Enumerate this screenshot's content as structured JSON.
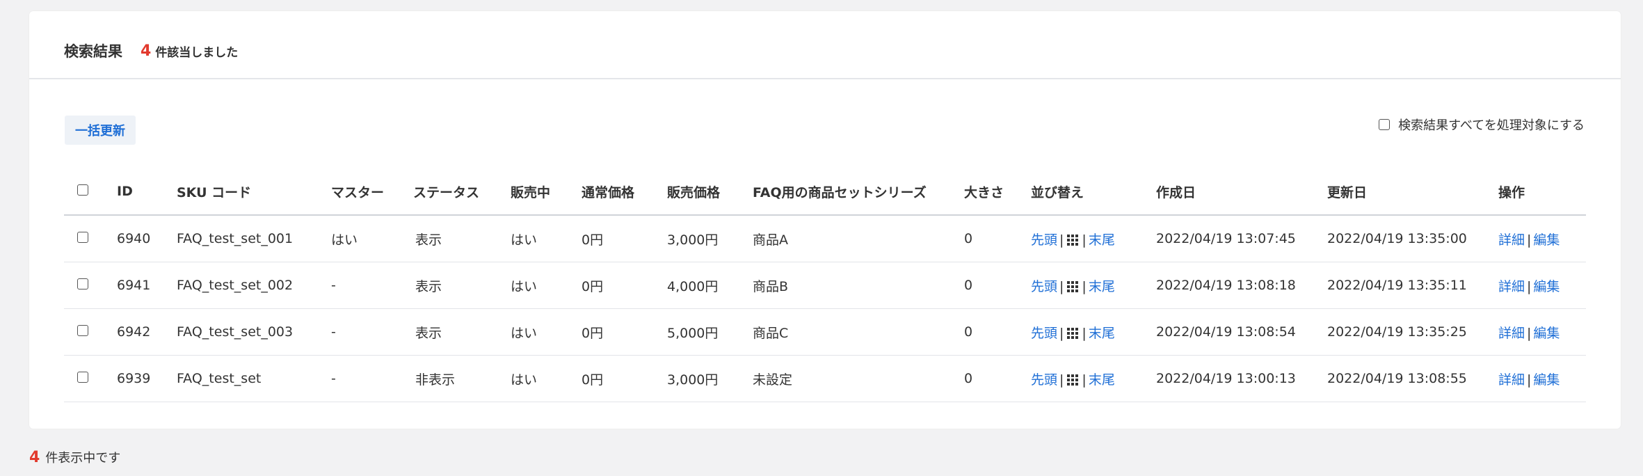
{
  "header": {
    "title": "検索結果",
    "count": "4",
    "count_suffix": "件該当しました"
  },
  "bulk_update_label": "一括更新",
  "all_target_label": "検索結果すべてを処理対象にする",
  "columns": {
    "id": "ID",
    "sku": "SKU コード",
    "master": "マスター",
    "status": "ステータス",
    "on_sale": "販売中",
    "regular_price": "通常価格",
    "sale_price": "販売価格",
    "series": "FAQ用の商品セットシリーズ",
    "size": "大きさ",
    "sort": "並び替え",
    "created": "作成日",
    "updated": "更新日",
    "actions": "操作"
  },
  "sort_labels": {
    "top": "先頭",
    "bottom": "末尾",
    "separator": "|"
  },
  "action_labels": {
    "detail": "詳細",
    "edit": "編集",
    "separator": "|"
  },
  "rows": [
    {
      "id": "6940",
      "sku": "FAQ_test_set_001",
      "master": "はい",
      "status": "表示",
      "on_sale": "はい",
      "regular_price": "0円",
      "sale_price": "3,000円",
      "series": "商品A",
      "size": "0",
      "created": "2022/04/19 13:07:45",
      "updated": "2022/04/19 13:35:00"
    },
    {
      "id": "6941",
      "sku": "FAQ_test_set_002",
      "master": "-",
      "status": "表示",
      "on_sale": "はい",
      "regular_price": "0円",
      "sale_price": "4,000円",
      "series": "商品B",
      "size": "0",
      "created": "2022/04/19 13:08:18",
      "updated": "2022/04/19 13:35:11"
    },
    {
      "id": "6942",
      "sku": "FAQ_test_set_003",
      "master": "-",
      "status": "表示",
      "on_sale": "はい",
      "regular_price": "0円",
      "sale_price": "5,000円",
      "series": "商品C",
      "size": "0",
      "created": "2022/04/19 13:08:54",
      "updated": "2022/04/19 13:35:25"
    },
    {
      "id": "6939",
      "sku": "FAQ_test_set",
      "master": "-",
      "status": "非表示",
      "on_sale": "はい",
      "regular_price": "0円",
      "sale_price": "3,000円",
      "series": "未設定",
      "size": "0",
      "created": "2022/04/19 13:00:13",
      "updated": "2022/04/19 13:08:55"
    }
  ],
  "footer": {
    "count": "4",
    "suffix": "件表示中です"
  },
  "colors": {
    "accent_red": "#e23a2e",
    "link_blue": "#1f6fd6",
    "page_bg": "#f2f2f3"
  }
}
